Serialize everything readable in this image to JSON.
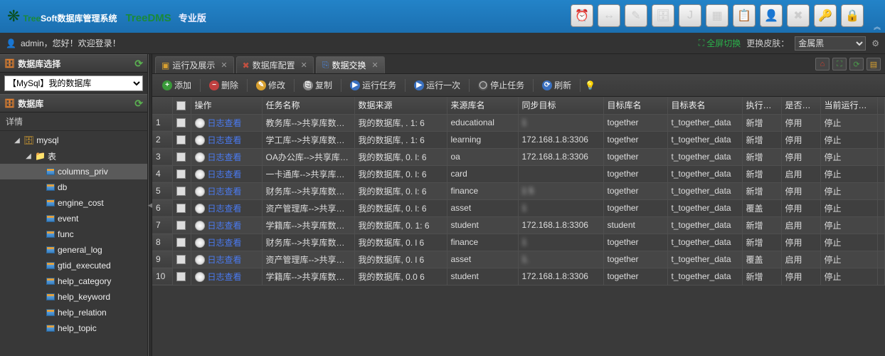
{
  "brand": {
    "tree": "Tree",
    "soft": "Soft",
    "title": "数据库管理系统",
    "sub": "TreeDMS",
    "edition": "专业版"
  },
  "userbar": {
    "greeting": "admin，您好！欢迎登录！",
    "fullscreen": "全屏切换",
    "skin_label": "更换皮肤：",
    "skin_value": "金属黑"
  },
  "sidebar": {
    "select_title": "数据库选择",
    "db_value": "【MySql】我的数据库",
    "db_panel": "数据库",
    "detail": "详情",
    "nodes": {
      "mysql": "mysql",
      "tables": "表",
      "items": [
        "columns_priv",
        "db",
        "engine_cost",
        "event",
        "func",
        "general_log",
        "gtid_executed",
        "help_category",
        "help_keyword",
        "help_relation",
        "help_topic"
      ]
    }
  },
  "tabs": [
    {
      "label": "运行及展示",
      "icon": "▣",
      "color": "#d8a030"
    },
    {
      "label": "数据库配置",
      "icon": "✖",
      "color": "#c05040"
    },
    {
      "label": "数据交换",
      "icon": "⎘",
      "color": "#4a80d0"
    }
  ],
  "toolbar": {
    "add": "添加",
    "del": "删除",
    "edit": "修改",
    "copy": "复制",
    "run": "运行任务",
    "run_once": "运行一次",
    "stop": "停止任务",
    "refresh": "刷新"
  },
  "grid": {
    "headers": {
      "op": "操作",
      "task": "任务名称",
      "src": "数据来源",
      "srctab": "来源库名",
      "tgt": "同步目标",
      "tgtdb": "目标库名",
      "tgttab": "目标表名",
      "act": "执行动作",
      "en": "是否启用",
      "st": "当前运行状态"
    },
    "log_link": "日志查看",
    "rows": [
      {
        "task": "教务库-->共享库数据同步",
        "src": "我的数据库,    . 1:    6",
        "srctab": "educational",
        "tgt": "1                  ",
        "tgtdb": "together",
        "tgttab": "t_together_data",
        "act": "新增",
        "en": "停用",
        "en_cls": "txt-red",
        "st": "停止",
        "st_cls": "txt-red"
      },
      {
        "task": "学工库-->共享库数据同步",
        "src": "我的数据库,    .  1:    6",
        "srctab": "learning",
        "tgt": "172.168.1.8:3306",
        "tgtdb": "together",
        "tgttab": "t_together_data",
        "act": "新增",
        "en": "停用",
        "en_cls": "txt-red",
        "st": "停止",
        "st_cls": "txt-red"
      },
      {
        "task": "OA办公库-->共享库数据",
        "src": "我的数据库,   0.   l:    6",
        "srctab": "oa",
        "tgt": "172.168.1.8:3306",
        "tgtdb": "together",
        "tgttab": "t_together_data",
        "act": "新增",
        "en": "停用",
        "en_cls": "txt-red",
        "st": "停止",
        "st_cls": "txt-red"
      },
      {
        "task": "一卡通库-->共享库数据",
        "src": "我的数据库,   0.   l:    6",
        "srctab": "card",
        "tgt": "                  ",
        "tgtdb": "together",
        "tgttab": "t_together_data",
        "act": "新增",
        "en": "启用",
        "en_cls": "txt-green",
        "st": "停止",
        "st_cls": "txt-red"
      },
      {
        "task": "财务库-->共享库数据同步",
        "src": "我的数据库,   0.   l:    6",
        "srctab": "finance",
        "tgt": "1                  5",
        "tgtdb": "together",
        "tgttab": "t_together_data",
        "act": "新增",
        "en": "停用",
        "en_cls": "txt-red",
        "st": "停止",
        "st_cls": "txt-red"
      },
      {
        "task": "资产管理库-->共享库数据",
        "src": "我的数据库,   0.   l:    6",
        "srctab": "asset",
        "tgt": "1                  ",
        "tgtdb": "together",
        "tgttab": "t_together_data",
        "act": "覆盖",
        "en": "停用",
        "en_cls": "txt-red",
        "st": "停止",
        "st_cls": "txt-red"
      },
      {
        "task": "学籍库-->共享库数据同步",
        "src": "我的数据库,   0.  1:    6",
        "srctab": "student",
        "tgt": "172.168.1.8:3306",
        "tgtdb": "student",
        "tgttab": "t_together_data",
        "act": "新增",
        "en": "启用",
        "en_cls": "txt-green",
        "st": "停止",
        "st_cls": "txt-red"
      },
      {
        "task": "财务库-->共享库数据同步",
        "src": "我的数据库,   0.   l    6",
        "srctab": "finance",
        "tgt": "1                  ",
        "tgtdb": "together",
        "tgttab": "t_together_data",
        "act": "新增",
        "en": "停用",
        "en_cls": "txt-red",
        "st": "停止",
        "st_cls": "txt-red"
      },
      {
        "task": "资产管理库-->共享库数据",
        "src": "我的数据库,   0.   l    6",
        "srctab": "asset",
        "tgt": "1.                 ",
        "tgtdb": "together",
        "tgttab": "t_together_data",
        "act": "覆盖",
        "en": "启用",
        "en_cls": "txt-green",
        "st": "停止",
        "st_cls": "txt-red"
      },
      {
        "task": "学籍库-->共享库数据同步",
        "src": "我的数据库,   0.0         6",
        "srctab": "student",
        "tgt": "172.168.1.8:3306",
        "tgtdb": "together",
        "tgttab": "t_together_data",
        "act": "新增",
        "en": "停用",
        "en_cls": "txt-red",
        "st": "停止",
        "st_cls": "txt-red"
      }
    ]
  },
  "top_icons": [
    "⏰",
    "↔",
    "✎",
    "🗄",
    "J",
    "▦",
    "📋",
    "👤",
    "✖",
    "🔑",
    "🔒"
  ]
}
